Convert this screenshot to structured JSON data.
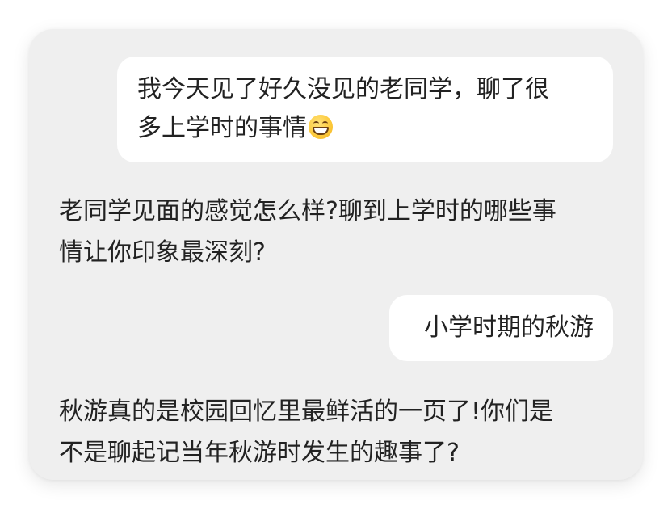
{
  "conversation": {
    "user_message_1": {
      "lines": [
        "我今天见了好久没见的老同学，聊了很",
        "多上学时的事情"
      ],
      "emoji": "grinning-face-with-smiling-eyes"
    },
    "assistant_message_1": {
      "lines": [
        "老同学见面的感觉怎么样?聊到上学时的哪些事",
        "情让你印象最深刻?"
      ]
    },
    "user_message_2": {
      "text": "小学时期的秋游"
    },
    "assistant_message_2": {
      "lines": [
        "秋游真的是校园回忆里最鲜活的一页了!你们是",
        "不是聊起记当年秋游时发生的趣事了?"
      ]
    }
  },
  "colors": {
    "card_background": "#efefef",
    "bubble_background": "#ffffff",
    "text": "#222222"
  }
}
